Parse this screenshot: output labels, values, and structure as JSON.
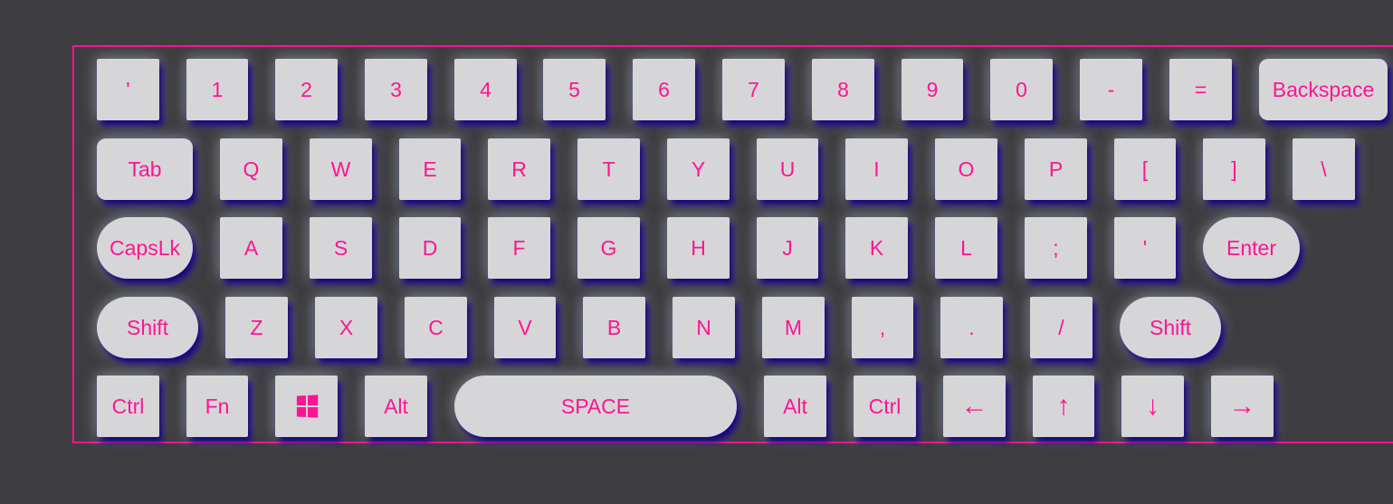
{
  "colors": {
    "background": "#3e3d40",
    "key_face": "#d6d6d8",
    "accent": "#ff1493",
    "key_shadow": "#150080"
  },
  "keyboard": {
    "rows": [
      {
        "keys": [
          {
            "id": "backtick",
            "label": "'"
          },
          {
            "id": "1",
            "label": "1"
          },
          {
            "id": "2",
            "label": "2"
          },
          {
            "id": "3",
            "label": "3"
          },
          {
            "id": "4",
            "label": "4"
          },
          {
            "id": "5",
            "label": "5"
          },
          {
            "id": "6",
            "label": "6"
          },
          {
            "id": "7",
            "label": "7"
          },
          {
            "id": "8",
            "label": "8"
          },
          {
            "id": "9",
            "label": "9"
          },
          {
            "id": "0",
            "label": "0"
          },
          {
            "id": "minus",
            "label": "-"
          },
          {
            "id": "equals",
            "label": "="
          },
          {
            "id": "backspace",
            "label": "Backspace"
          }
        ]
      },
      {
        "keys": [
          {
            "id": "tab",
            "label": "Tab"
          },
          {
            "id": "q",
            "label": "Q"
          },
          {
            "id": "w",
            "label": "W"
          },
          {
            "id": "e",
            "label": "E"
          },
          {
            "id": "r",
            "label": "R"
          },
          {
            "id": "t",
            "label": "T"
          },
          {
            "id": "y",
            "label": "Y"
          },
          {
            "id": "u",
            "label": "U"
          },
          {
            "id": "i",
            "label": "I"
          },
          {
            "id": "o",
            "label": "O"
          },
          {
            "id": "p",
            "label": "P"
          },
          {
            "id": "left-bracket",
            "label": "["
          },
          {
            "id": "right-bracket",
            "label": "]"
          },
          {
            "id": "backslash",
            "label": "\\"
          }
        ]
      },
      {
        "keys": [
          {
            "id": "capslock",
            "label": "CapsLk"
          },
          {
            "id": "a",
            "label": "A"
          },
          {
            "id": "s",
            "label": "S"
          },
          {
            "id": "d",
            "label": "D"
          },
          {
            "id": "f",
            "label": "F"
          },
          {
            "id": "g",
            "label": "G"
          },
          {
            "id": "h",
            "label": "H"
          },
          {
            "id": "j",
            "label": "J"
          },
          {
            "id": "k",
            "label": "K"
          },
          {
            "id": "l",
            "label": "L"
          },
          {
            "id": "semicolon",
            "label": ";"
          },
          {
            "id": "quote",
            "label": "'"
          },
          {
            "id": "enter",
            "label": "Enter"
          }
        ]
      },
      {
        "keys": [
          {
            "id": "shift-left",
            "label": "Shift"
          },
          {
            "id": "z",
            "label": "Z"
          },
          {
            "id": "x",
            "label": "X"
          },
          {
            "id": "c",
            "label": "C"
          },
          {
            "id": "v",
            "label": "V"
          },
          {
            "id": "b",
            "label": "B"
          },
          {
            "id": "n",
            "label": "N"
          },
          {
            "id": "m",
            "label": "M"
          },
          {
            "id": "comma",
            "label": ","
          },
          {
            "id": "period",
            "label": "."
          },
          {
            "id": "slash",
            "label": "/"
          },
          {
            "id": "shift-right",
            "label": "Shift"
          }
        ]
      },
      {
        "keys": [
          {
            "id": "ctrl-left",
            "label": "Ctrl"
          },
          {
            "id": "fn",
            "label": "Fn"
          },
          {
            "id": "windows",
            "label": "",
            "icon": "windows-logo-icon"
          },
          {
            "id": "alt-left",
            "label": "Alt"
          },
          {
            "id": "space",
            "label": "SPACE"
          },
          {
            "id": "alt-right",
            "label": "Alt"
          },
          {
            "id": "ctrl-right",
            "label": "Ctrl"
          },
          {
            "id": "arrow-left",
            "label": "←"
          },
          {
            "id": "arrow-up",
            "label": "↑"
          },
          {
            "id": "arrow-down",
            "label": "↓"
          },
          {
            "id": "arrow-right",
            "label": "→"
          }
        ]
      }
    ]
  }
}
